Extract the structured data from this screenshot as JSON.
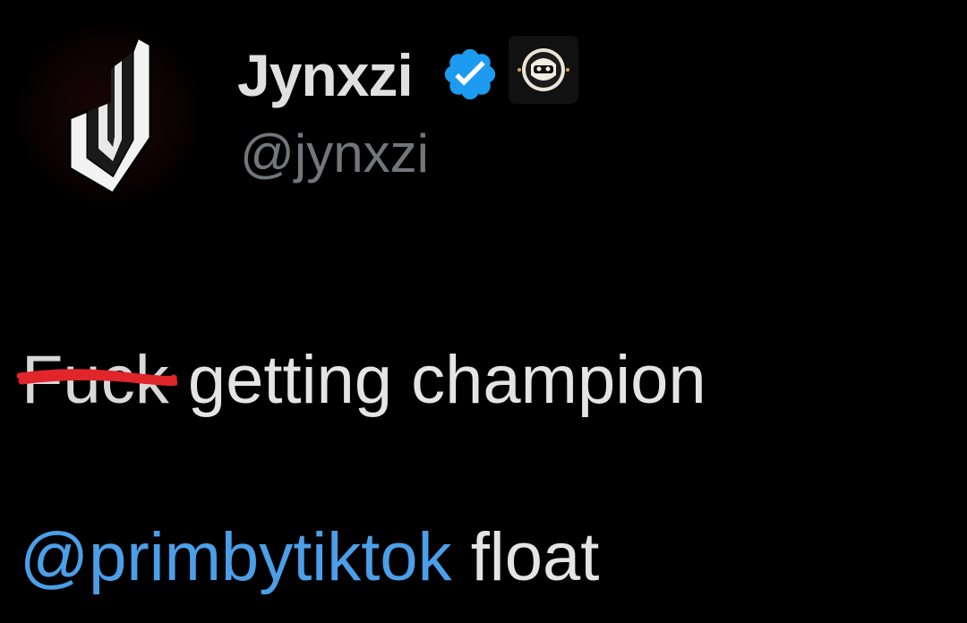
{
  "tweet": {
    "author": {
      "display_name": "Jynxzi",
      "handle": "@jynxzi",
      "avatar_icon": "jynxzi-j-logo-icon",
      "verified_icon": "verified-badge-icon",
      "affiliate_icon": "affiliate-org-badge-icon"
    },
    "body": {
      "censored_word": "Fuck",
      "line1_rest": " getting champion",
      "mention": "@primbytiktok",
      "line2_rest": " float"
    }
  },
  "colors": {
    "background": "#000000",
    "mention_blue": "#4b9fe8",
    "verified_blue": "#1d9bf0",
    "handle_gray": "#71767b",
    "scribble_red": "#e0262b"
  }
}
